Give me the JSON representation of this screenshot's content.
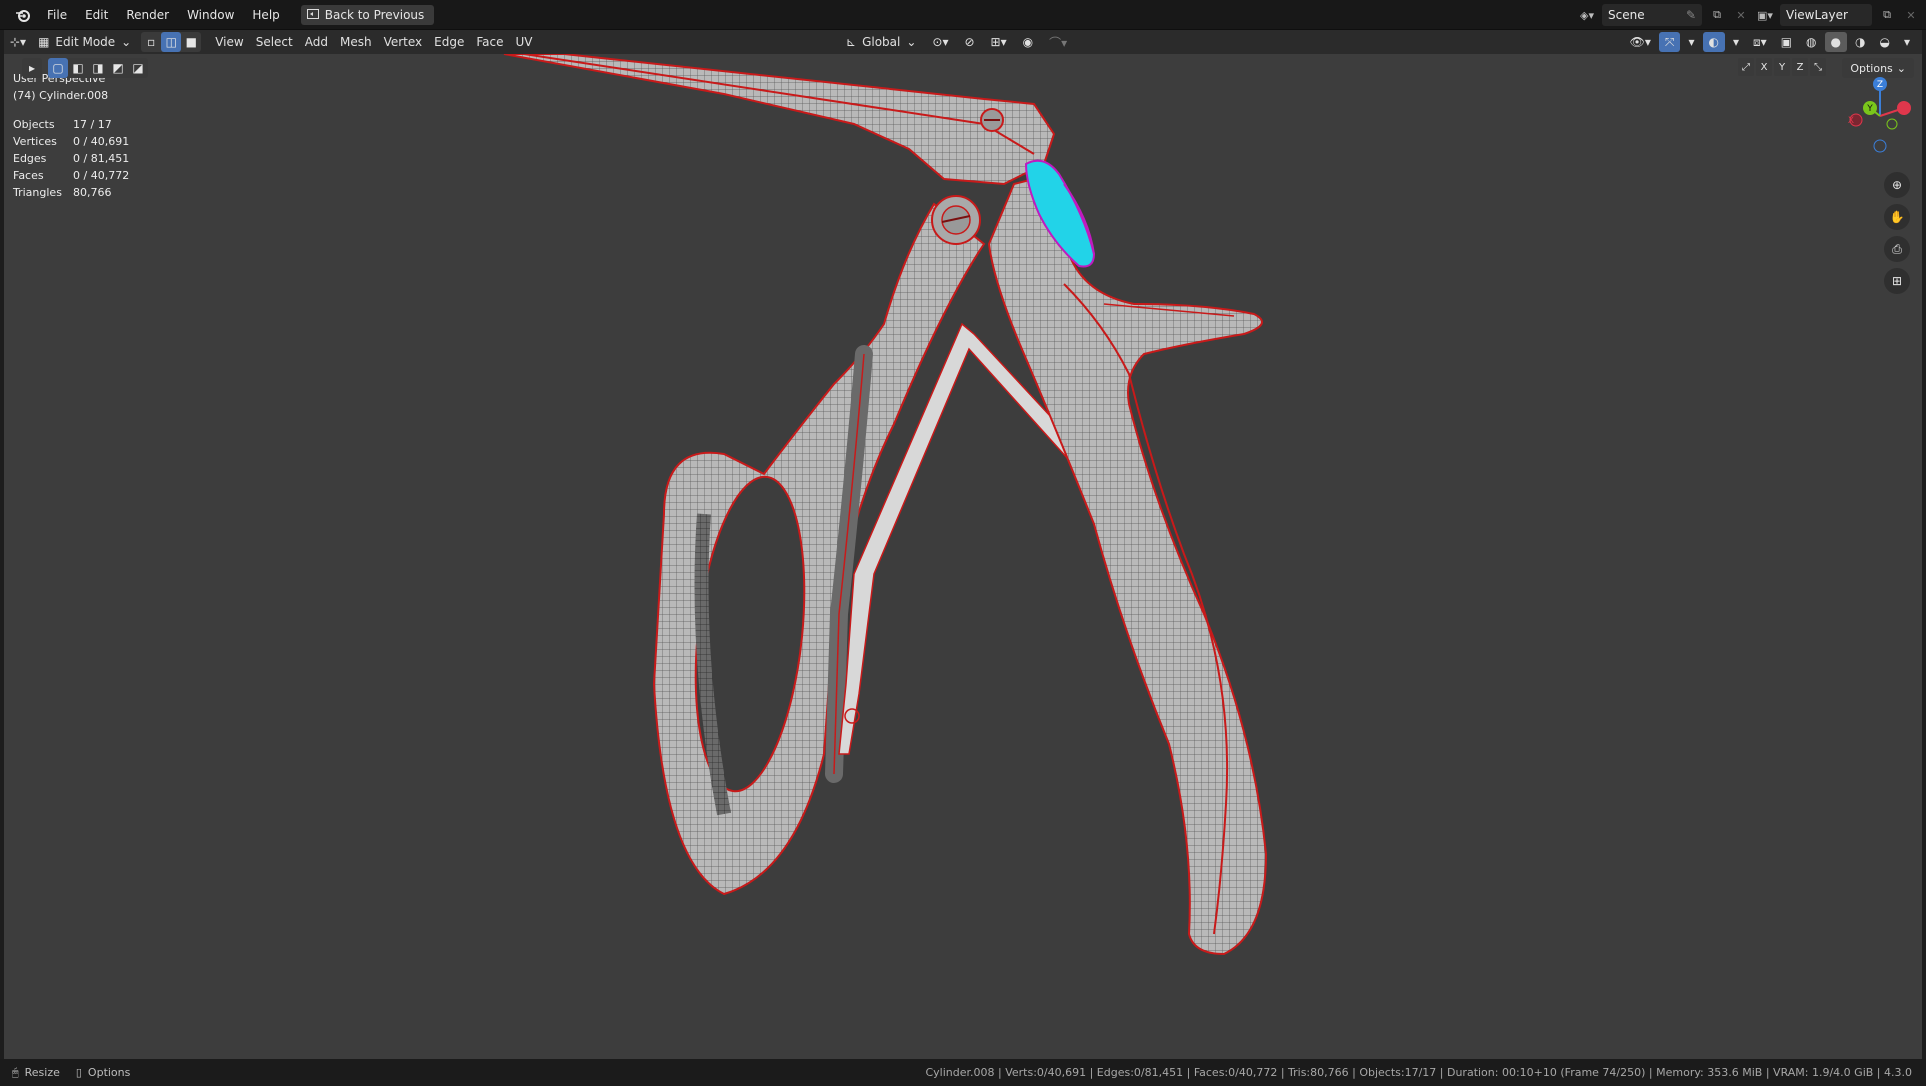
{
  "menubar": {
    "items": [
      "File",
      "Edit",
      "Render",
      "Window",
      "Help"
    ],
    "back_button": "Back to Previous",
    "scene": "Scene",
    "view_layer": "ViewLayer"
  },
  "header": {
    "mode": "Edit Mode",
    "menus": [
      "View",
      "Select",
      "Add",
      "Mesh",
      "Vertex",
      "Edge",
      "Face",
      "UV"
    ],
    "transform_orientation": "Global",
    "options_label": "Options",
    "axes": [
      "X",
      "Y",
      "Z"
    ]
  },
  "overlay": {
    "view_name": "User Perspective",
    "object_name": "(74) Cylinder.008",
    "stats": [
      {
        "label": "Objects",
        "value": "17 / 17"
      },
      {
        "label": "Vertices",
        "value": "0 / 40,691"
      },
      {
        "label": "Edges",
        "value": "0 / 81,451"
      },
      {
        "label": "Faces",
        "value": "0 / 40,772"
      },
      {
        "label": "Triangles",
        "value": "80,766"
      }
    ]
  },
  "gizmo": {
    "z": "Z",
    "y": "Y",
    "x": "X"
  },
  "statusbar": {
    "left_items": [
      "Resize",
      "Options"
    ],
    "info": "Cylinder.008 | Verts:0/40,691 | Edges:0/81,451 | Faces:0/40,772 | Tris:80,766 | Objects:17/17 | Duration: 00:10+10 (Frame 74/250) | Memory: 353.6 MiB | VRAM: 1.9/4.0 GiB | 4.3.0"
  },
  "colors": {
    "viewport_bg": "#3d3d3d",
    "seam_red": "#c81a1a",
    "selection_cyan": "#22d3e8",
    "active_blue": "#4772b3"
  }
}
